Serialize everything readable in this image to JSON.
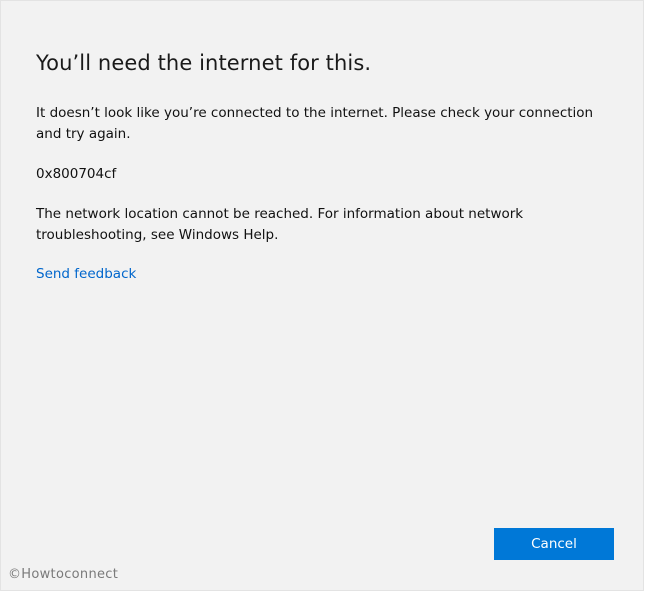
{
  "dialog": {
    "title": "You’ll need the internet for this.",
    "message": "It doesn’t look like you’re connected to the internet. Please check your connection and try again.",
    "error_code": "0x800704cf",
    "details": "The network location cannot be reached. For information about network troubleshooting, see Windows Help.",
    "feedback_link": "Send feedback",
    "cancel_label": "Cancel"
  },
  "watermark": "©Howtoconnect",
  "colors": {
    "background": "#f2f2f2",
    "link": "#0066cc",
    "button": "#0078d7",
    "button_text": "#ffffff"
  }
}
